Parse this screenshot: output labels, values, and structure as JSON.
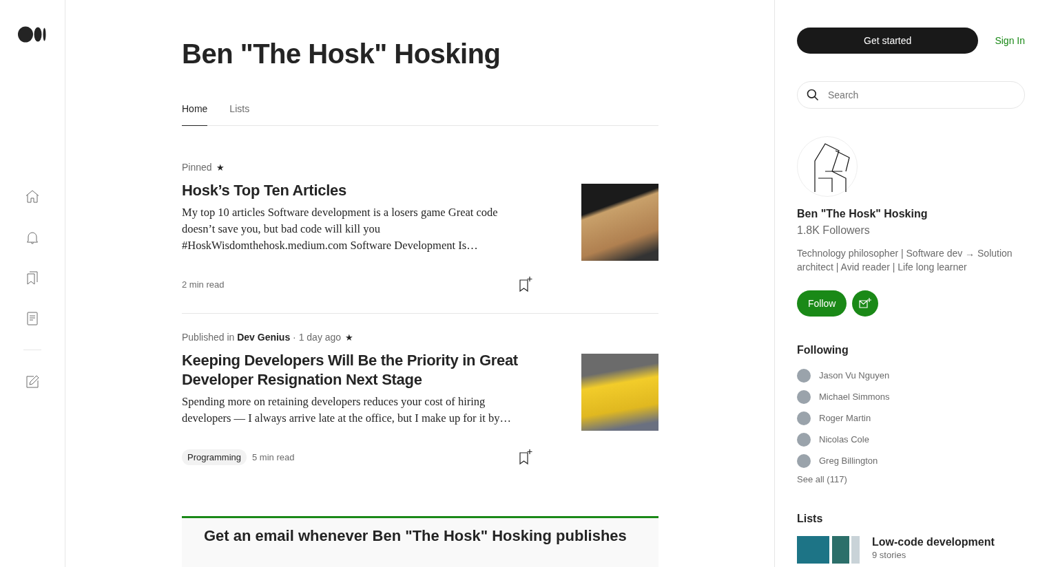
{
  "profile_name": "Ben \"The Hosk\" Hosking",
  "tabs": [
    {
      "label": "Home",
      "selected": true
    },
    {
      "label": "Lists",
      "selected": false
    }
  ],
  "articles": [
    {
      "meta": "Pinned",
      "star": "★",
      "title": "Hosk’s Top Ten Articles",
      "excerpt": "My top 10 articles Software development is a losers game Great code doesn’t save you, but bad code will kill you #HoskWisdomthehosk.medium.com Software Development Is…",
      "read_time": "2 min read"
    },
    {
      "meta": "Published in **Dev Genius** · 1 day ago",
      "star": "★",
      "title": "Keeping Developers Will Be the Priority in Great Developer Resignation Next Stage",
      "excerpt": "Spending more on retaining developers reduces your cost of hiring developers — I always arrive late at the office, but I make up for it by…",
      "tag": "Programming",
      "read_time": "5 min read"
    }
  ],
  "email_card": {
    "title": "Get an email whenever Ben \"The Hosk\" Hosking publishes"
  },
  "get_started": "Get started",
  "sign_in": "Sign In",
  "search": {
    "placeholder": "Search"
  },
  "author": {
    "name": "Ben \"The Hosk\" Hosking",
    "followers": "1.8K Followers",
    "bio": "Technology philosopher | Software dev → Solution architect | Avid reader | Life long learner",
    "follow": "Follow"
  },
  "following": {
    "title": "Following",
    "people": [
      {
        "name": "Jason Vu Nguyen"
      },
      {
        "name": "Michael Simmons"
      },
      {
        "name": "Roger Martin"
      },
      {
        "name": "Nicolas Cole"
      },
      {
        "name": "Greg Billington"
      }
    ],
    "see_all": "See all (117)"
  },
  "lists": {
    "title": "Lists",
    "items": [
      {
        "title": "Low-code development",
        "count": "9 stories"
      }
    ]
  }
}
